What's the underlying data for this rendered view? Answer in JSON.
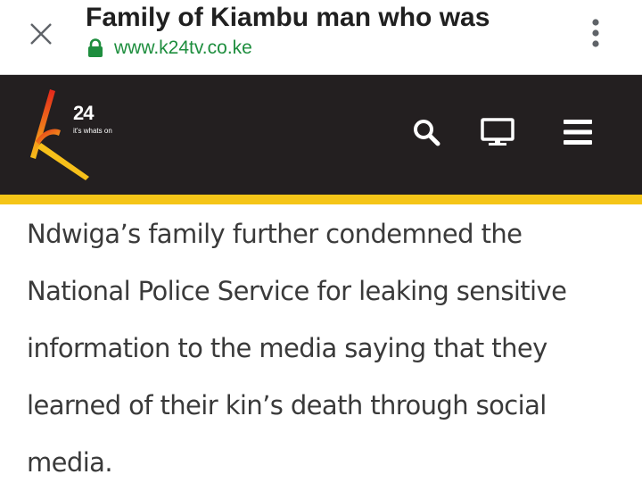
{
  "browser": {
    "page_title": "Family of Kiambu man who was",
    "url": "www.k24tv.co.ke",
    "close_icon": "close-icon",
    "lock_icon": "lock-icon",
    "menu_icon": "more-vert-icon"
  },
  "site_header": {
    "logo_number": "24",
    "logo_tagline": "it's whats on",
    "icons": [
      "search-icon",
      "tv-icon",
      "hamburger-menu-icon"
    ],
    "colors": {
      "header_bg": "#231f20",
      "stripe": "#f5c518",
      "logo_gradient_start": "#e4261b",
      "logo_gradient_end": "#f7c01a"
    }
  },
  "article": {
    "paragraph": "Ndwiga’s family further condemned the National Police Service for leaking sensitive information to the media saying that they learned of their kin’s death through social media."
  }
}
